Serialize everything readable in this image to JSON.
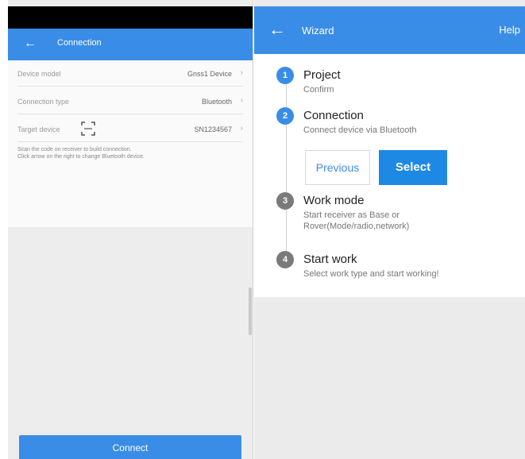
{
  "left": {
    "appbar": {
      "title": "Connection"
    },
    "form": {
      "rows": [
        {
          "label": "Device model",
          "value": "Gnss1 Device"
        },
        {
          "label": "Connection type",
          "value": "Bluetooth"
        },
        {
          "label": "Target device",
          "value": "SN1234567"
        }
      ],
      "note_line1": "Scan the code on receiver to build connection.",
      "note_line2": "Click arrow on the right to change Bluetooth device."
    },
    "connect_label": "Connect"
  },
  "right": {
    "appbar": {
      "title": "Wizard",
      "help": "Help"
    },
    "steps": [
      {
        "num": "1",
        "title": "Project",
        "desc": "Confirm"
      },
      {
        "num": "2",
        "title": "Connection",
        "desc": "Connect device via Bluetooth"
      },
      {
        "num": "3",
        "title": "Work mode",
        "desc": "Start receiver as Base or Rover(Mode/radio,network)"
      },
      {
        "num": "4",
        "title": "Start work",
        "desc": "Select work type and start working!"
      }
    ],
    "buttons": {
      "previous": "Previous",
      "select": "Select"
    }
  },
  "colors": {
    "accent": "#3a8de6",
    "inactive_step": "#7a7a7a"
  },
  "icons": {
    "back": "arrow-left-icon",
    "scan": "qr-scan-icon",
    "chevron": "chevron-right-icon"
  }
}
